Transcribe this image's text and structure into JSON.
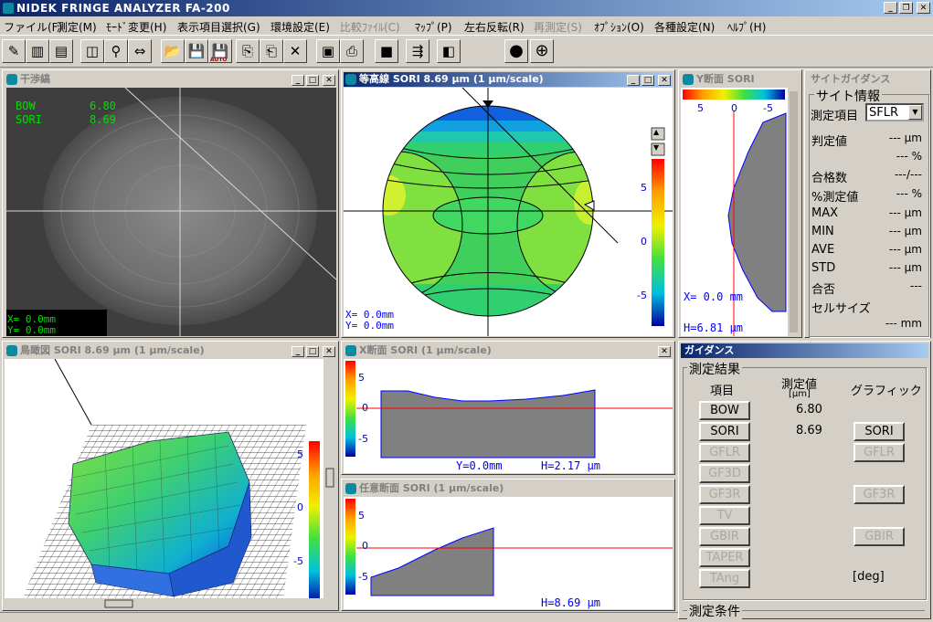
{
  "app": {
    "title": "NIDEK FRINGE ANALYZER FA-200"
  },
  "menu": [
    {
      "label": "ファイル(F)",
      "enabled": true
    },
    {
      "label": "測定(M)",
      "enabled": true
    },
    {
      "label": "ﾓｰﾄﾞ変更(H)",
      "enabled": true
    },
    {
      "label": "表示項目選択(G)",
      "enabled": true
    },
    {
      "label": "環境設定(E)",
      "enabled": true
    },
    {
      "label": "比較ﾌｧｲﾙ(C)",
      "enabled": false
    },
    {
      "label": "ﾏｯﾌﾟ(P)",
      "enabled": true
    },
    {
      "label": "左右反転(R)",
      "enabled": true
    },
    {
      "label": "再測定(S)",
      "enabled": false
    },
    {
      "label": "ｵﾌﾟｼｮﾝ(O)",
      "enabled": true
    },
    {
      "label": "各種設定(N)",
      "enabled": true
    },
    {
      "label": "ﾍﾙﾌﾟ(H)",
      "enabled": true
    }
  ],
  "toolbar_icons": [
    "measure-icon",
    "mode-icon",
    "display-icon",
    "view-icon",
    "zoom-icon",
    "flip-icon",
    "open-folder-icon",
    "save-icon",
    "auto-save-icon",
    "copy-icon",
    "paste-icon",
    "delete-icon",
    "print-preview-icon",
    "print-icon",
    "stop-icon",
    "calc-icon",
    "frame-icon",
    "circle-icon",
    "crosshair-circle-icon"
  ],
  "toolbar": {
    "auto_badge": "AUTO"
  },
  "interferogram": {
    "title": "干渉縞",
    "bow_label": "BOW",
    "bow_value": "6.80",
    "sori_label": "SORI",
    "sori_value": "8.69",
    "x_readout": "X=   0.0mm",
    "y_readout": "Y=   0.0mm"
  },
  "contour": {
    "title": "等高線 SORI 8.69 μm (1 μm/scale)",
    "x_readout": "X=   0.0mm",
    "y_readout": "Y=   0.0mm",
    "scale_ticks": [
      "5",
      "0",
      "-5"
    ]
  },
  "y_section": {
    "title": "Y断面 SORI",
    "scale_ticks": [
      "5",
      "0",
      "-5"
    ],
    "x_readout": "X=   0.0 mm",
    "h_readout": "H=6.81 μm"
  },
  "side_panel": {
    "title": "サイトガイダンス",
    "group": "サイト情報",
    "item_label": "測定項目",
    "item_value": "SFLR",
    "rows": [
      {
        "label": "判定値",
        "value": "--- μm"
      },
      {
        "label": "",
        "value": "--- %"
      },
      {
        "label": "合格数",
        "value": "---/---"
      },
      {
        "label": "%測定値",
        "value": "--- %"
      },
      {
        "label": "MAX",
        "value": "--- μm"
      },
      {
        "label": "MIN",
        "value": "--- μm"
      },
      {
        "label": "AVE",
        "value": "--- μm"
      },
      {
        "label": "STD",
        "value": "--- μm"
      },
      {
        "label": "合否",
        "value": "---"
      },
      {
        "label": "セルサイズ",
        "value": ""
      },
      {
        "label": "",
        "value": "--- mm"
      }
    ]
  },
  "birdseye": {
    "title": "鳥瞰図 SORI 8.69 μm (1 μm/scale)",
    "scale_ticks": [
      "5",
      "0",
      "-5"
    ]
  },
  "x_section": {
    "title": "X断面 SORI (1 μm/scale)",
    "scale_ticks": [
      "5",
      "0",
      "-5"
    ],
    "y_readout": "Y=0.0mm",
    "h_readout": "H=2.17 μm"
  },
  "any_section": {
    "title": "任意断面 SORI (1 μm/scale)",
    "scale_ticks": [
      "5",
      "0",
      "-5"
    ],
    "h_readout": "H=8.69 μm"
  },
  "guidance": {
    "title": "ガイダンス",
    "results_group": "測定結果",
    "col_item": "項目",
    "col_value": "測定値",
    "col_unit": "[μm]",
    "col_graphic": "グラフィック",
    "items": [
      {
        "label": "BOW",
        "value": "6.80",
        "enabled": true,
        "graphic": ""
      },
      {
        "label": "SORI",
        "value": "8.69",
        "enabled": true,
        "graphic": "SORI"
      },
      {
        "label": "GFLR",
        "value": "",
        "enabled": false,
        "graphic": "GFLR"
      },
      {
        "label": "GF3D",
        "value": "",
        "enabled": false,
        "graphic": ""
      },
      {
        "label": "GF3R",
        "value": "",
        "enabled": false,
        "graphic": "GF3R"
      },
      {
        "label": "TV",
        "value": "",
        "enabled": false,
        "graphic": ""
      },
      {
        "label": "GBIR",
        "value": "",
        "enabled": false,
        "graphic": "GBIR"
      },
      {
        "label": "TAPER",
        "value": "",
        "enabled": false,
        "graphic": ""
      },
      {
        "label": "TAng",
        "value": "",
        "enabled": false,
        "graphic": "[deg]"
      }
    ],
    "conditions_group": "測定条件"
  },
  "colors": {
    "title_active": "#0a246a",
    "face": "#d4d0c8",
    "plot_fill": "#808080",
    "line_blue": "#0000ff",
    "line_red": "#ff0000"
  }
}
